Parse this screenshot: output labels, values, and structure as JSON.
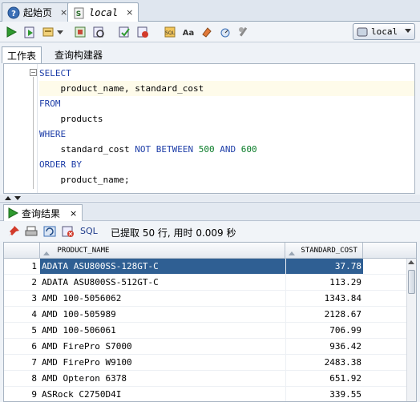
{
  "doc_tabs": [
    {
      "label": "起始页",
      "close": "×"
    },
    {
      "label": "local",
      "close": "×"
    }
  ],
  "connection": {
    "selected": "local"
  },
  "sub_tabs": [
    {
      "label": "工作表"
    },
    {
      "label": "查询构建器"
    }
  ],
  "editor": {
    "lines": [
      {
        "kw": "SELECT",
        "text": ""
      },
      {
        "kw": "",
        "text": "    product_name, standard_cost"
      },
      {
        "kw": "FROM",
        "text": ""
      },
      {
        "kw": "",
        "text": "    products"
      },
      {
        "kw": "WHERE",
        "text": ""
      },
      {
        "kw": "",
        "text": "    standard_cost "
      },
      {
        "kw": "ORDER BY",
        "text": ""
      },
      {
        "kw": "",
        "text": "    product_name;"
      }
    ],
    "where_kw1": "NOT BETWEEN",
    "where_num1": "500",
    "where_kw2": "AND",
    "where_num2": "600"
  },
  "results": {
    "tab_label": "查询结果",
    "tab_close": "×",
    "sql_label": "SQL",
    "info": "已提取 50 行, 用时 0.009 秒",
    "columns": [
      "PRODUCT_NAME",
      "STANDARD_COST"
    ],
    "rows": [
      {
        "no": "1",
        "name": "ADATA ASU800SS-128GT-C",
        "cost": "37.78"
      },
      {
        "no": "2",
        "name": "ADATA ASU800SS-512GT-C",
        "cost": "113.29"
      },
      {
        "no": "3",
        "name": "AMD 100-5056062",
        "cost": "1343.84"
      },
      {
        "no": "4",
        "name": "AMD 100-505989",
        "cost": "2128.67"
      },
      {
        "no": "5",
        "name": "AMD 100-506061",
        "cost": "706.99"
      },
      {
        "no": "6",
        "name": "AMD FirePro S7000",
        "cost": "936.42"
      },
      {
        "no": "7",
        "name": "AMD FirePro W9100",
        "cost": "2483.38"
      },
      {
        "no": "8",
        "name": "AMD Opteron 6378",
        "cost": "651.92"
      },
      {
        "no": "9",
        "name": "ASRock C2750D4I",
        "cost": "339.55"
      }
    ]
  },
  "icons": {
    "start_page": "help-icon",
    "worksheet": "sql-worksheet-icon",
    "run": "run-statement-icon",
    "run_script": "run-script-icon",
    "commit": "commit-icon",
    "rollback": "rollback-icon"
  },
  "colors": {
    "selection": "#2f5f93",
    "keyword": "#1e3ea8",
    "number": "#0b7d2a"
  }
}
